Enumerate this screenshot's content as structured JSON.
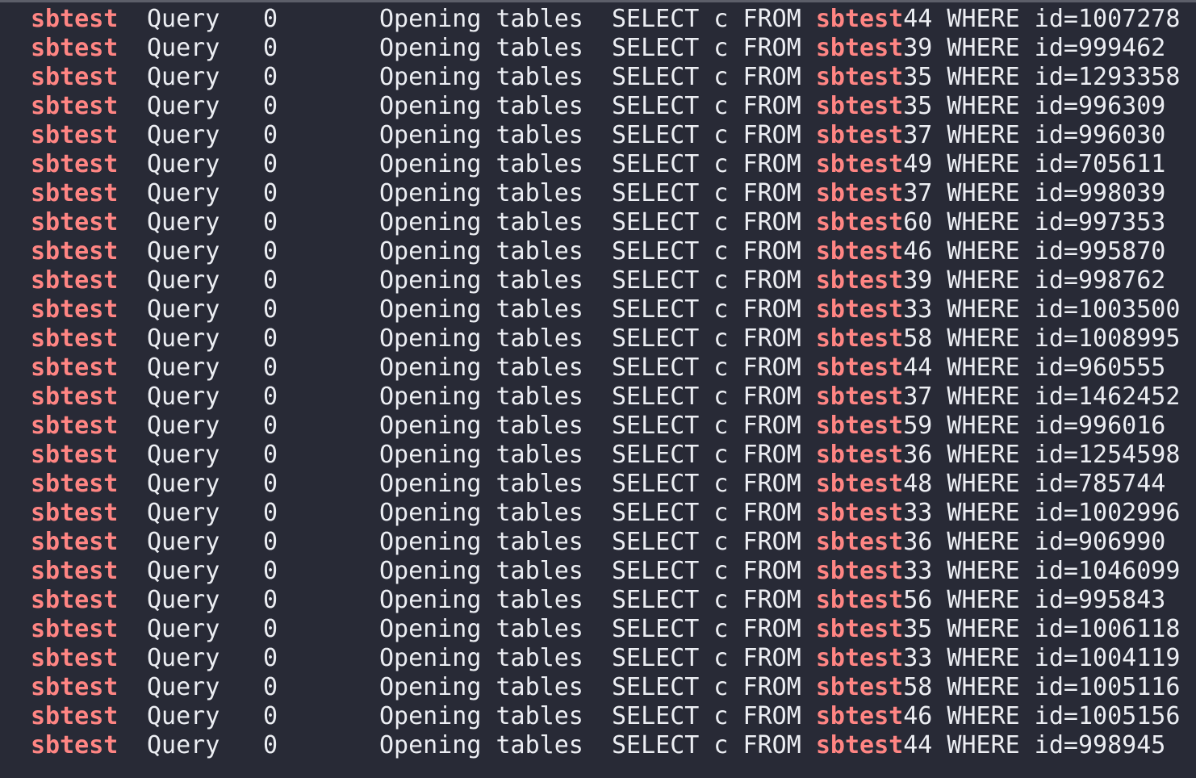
{
  "colors": {
    "background": "#282a36",
    "text": "#eceef3",
    "highlight": "#ff8583"
  },
  "rows": [
    {
      "user": "sbtest",
      "command": "Query",
      "time": "0",
      "state": "Opening tables",
      "query_prefix": "SELECT c FROM ",
      "table_hl": "sbtest",
      "table_num": "44",
      "query_suffix": " WHERE id=1007278"
    },
    {
      "user": "sbtest",
      "command": "Query",
      "time": "0",
      "state": "Opening tables",
      "query_prefix": "SELECT c FROM ",
      "table_hl": "sbtest",
      "table_num": "39",
      "query_suffix": " WHERE id=999462"
    },
    {
      "user": "sbtest",
      "command": "Query",
      "time": "0",
      "state": "Opening tables",
      "query_prefix": "SELECT c FROM ",
      "table_hl": "sbtest",
      "table_num": "35",
      "query_suffix": " WHERE id=1293358"
    },
    {
      "user": "sbtest",
      "command": "Query",
      "time": "0",
      "state": "Opening tables",
      "query_prefix": "SELECT c FROM ",
      "table_hl": "sbtest",
      "table_num": "35",
      "query_suffix": " WHERE id=996309"
    },
    {
      "user": "sbtest",
      "command": "Query",
      "time": "0",
      "state": "Opening tables",
      "query_prefix": "SELECT c FROM ",
      "table_hl": "sbtest",
      "table_num": "37",
      "query_suffix": " WHERE id=996030"
    },
    {
      "user": "sbtest",
      "command": "Query",
      "time": "0",
      "state": "Opening tables",
      "query_prefix": "SELECT c FROM ",
      "table_hl": "sbtest",
      "table_num": "49",
      "query_suffix": " WHERE id=705611"
    },
    {
      "user": "sbtest",
      "command": "Query",
      "time": "0",
      "state": "Opening tables",
      "query_prefix": "SELECT c FROM ",
      "table_hl": "sbtest",
      "table_num": "37",
      "query_suffix": " WHERE id=998039"
    },
    {
      "user": "sbtest",
      "command": "Query",
      "time": "0",
      "state": "Opening tables",
      "query_prefix": "SELECT c FROM ",
      "table_hl": "sbtest",
      "table_num": "60",
      "query_suffix": " WHERE id=997353"
    },
    {
      "user": "sbtest",
      "command": "Query",
      "time": "0",
      "state": "Opening tables",
      "query_prefix": "SELECT c FROM ",
      "table_hl": "sbtest",
      "table_num": "46",
      "query_suffix": " WHERE id=995870"
    },
    {
      "user": "sbtest",
      "command": "Query",
      "time": "0",
      "state": "Opening tables",
      "query_prefix": "SELECT c FROM ",
      "table_hl": "sbtest",
      "table_num": "39",
      "query_suffix": " WHERE id=998762"
    },
    {
      "user": "sbtest",
      "command": "Query",
      "time": "0",
      "state": "Opening tables",
      "query_prefix": "SELECT c FROM ",
      "table_hl": "sbtest",
      "table_num": "33",
      "query_suffix": " WHERE id=1003500"
    },
    {
      "user": "sbtest",
      "command": "Query",
      "time": "0",
      "state": "Opening tables",
      "query_prefix": "SELECT c FROM ",
      "table_hl": "sbtest",
      "table_num": "58",
      "query_suffix": " WHERE id=1008995"
    },
    {
      "user": "sbtest",
      "command": "Query",
      "time": "0",
      "state": "Opening tables",
      "query_prefix": "SELECT c FROM ",
      "table_hl": "sbtest",
      "table_num": "44",
      "query_suffix": " WHERE id=960555"
    },
    {
      "user": "sbtest",
      "command": "Query",
      "time": "0",
      "state": "Opening tables",
      "query_prefix": "SELECT c FROM ",
      "table_hl": "sbtest",
      "table_num": "37",
      "query_suffix": " WHERE id=1462452"
    },
    {
      "user": "sbtest",
      "command": "Query",
      "time": "0",
      "state": "Opening tables",
      "query_prefix": "SELECT c FROM ",
      "table_hl": "sbtest",
      "table_num": "59",
      "query_suffix": " WHERE id=996016"
    },
    {
      "user": "sbtest",
      "command": "Query",
      "time": "0",
      "state": "Opening tables",
      "query_prefix": "SELECT c FROM ",
      "table_hl": "sbtest",
      "table_num": "36",
      "query_suffix": " WHERE id=1254598"
    },
    {
      "user": "sbtest",
      "command": "Query",
      "time": "0",
      "state": "Opening tables",
      "query_prefix": "SELECT c FROM ",
      "table_hl": "sbtest",
      "table_num": "48",
      "query_suffix": " WHERE id=785744"
    },
    {
      "user": "sbtest",
      "command": "Query",
      "time": "0",
      "state": "Opening tables",
      "query_prefix": "SELECT c FROM ",
      "table_hl": "sbtest",
      "table_num": "33",
      "query_suffix": " WHERE id=1002996"
    },
    {
      "user": "sbtest",
      "command": "Query",
      "time": "0",
      "state": "Opening tables",
      "query_prefix": "SELECT c FROM ",
      "table_hl": "sbtest",
      "table_num": "36",
      "query_suffix": " WHERE id=906990"
    },
    {
      "user": "sbtest",
      "command": "Query",
      "time": "0",
      "state": "Opening tables",
      "query_prefix": "SELECT c FROM ",
      "table_hl": "sbtest",
      "table_num": "33",
      "query_suffix": " WHERE id=1046099"
    },
    {
      "user": "sbtest",
      "command": "Query",
      "time": "0",
      "state": "Opening tables",
      "query_prefix": "SELECT c FROM ",
      "table_hl": "sbtest",
      "table_num": "56",
      "query_suffix": " WHERE id=995843"
    },
    {
      "user": "sbtest",
      "command": "Query",
      "time": "0",
      "state": "Opening tables",
      "query_prefix": "SELECT c FROM ",
      "table_hl": "sbtest",
      "table_num": "35",
      "query_suffix": " WHERE id=1006118"
    },
    {
      "user": "sbtest",
      "command": "Query",
      "time": "0",
      "state": "Opening tables",
      "query_prefix": "SELECT c FROM ",
      "table_hl": "sbtest",
      "table_num": "33",
      "query_suffix": " WHERE id=1004119"
    },
    {
      "user": "sbtest",
      "command": "Query",
      "time": "0",
      "state": "Opening tables",
      "query_prefix": "SELECT c FROM ",
      "table_hl": "sbtest",
      "table_num": "58",
      "query_suffix": " WHERE id=1005116"
    },
    {
      "user": "sbtest",
      "command": "Query",
      "time": "0",
      "state": "Opening tables",
      "query_prefix": "SELECT c FROM ",
      "table_hl": "sbtest",
      "table_num": "46",
      "query_suffix": " WHERE id=1005156"
    },
    {
      "user": "sbtest",
      "command": "Query",
      "time": "0",
      "state": "Opening tables",
      "query_prefix": "SELECT c FROM ",
      "table_hl": "sbtest",
      "table_num": "44",
      "query_suffix": " WHERE id=998945"
    }
  ]
}
